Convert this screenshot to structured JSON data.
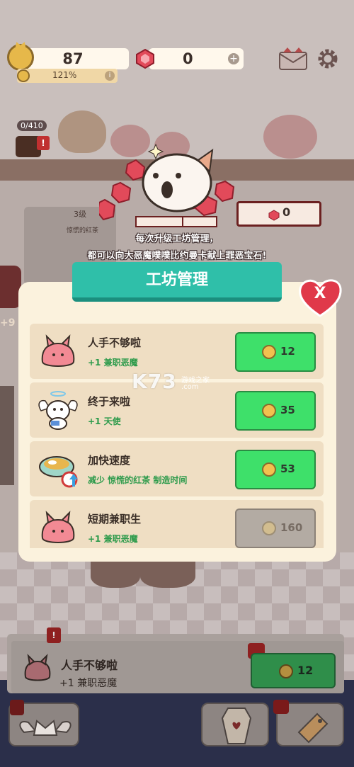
{
  "hud": {
    "coins": "87",
    "coin_rate": "121%",
    "gems": "0",
    "info_symbol": "i",
    "plus_symbol": "+"
  },
  "background": {
    "seat_counter": "0/410",
    "machine_level": "3级",
    "machine_product": "惊慌的红茶",
    "partial_value": "+9"
  },
  "reward": {
    "gem_count": "0",
    "tip_line1": "每次升级工坊管理，",
    "tip_line2": "都可以向大恶魔噗噗比约曼卡献上罪恶宝石!"
  },
  "modal": {
    "title": "工坊管理",
    "close_label": "X",
    "items": [
      {
        "title": "人手不够啦",
        "desc": "+1 兼职恶魔",
        "cost": "12",
        "enabled": true,
        "icon": "pink-demon-blob-icon"
      },
      {
        "title": "终于来啦",
        "desc": "+1 天使",
        "cost": "35",
        "enabled": true,
        "icon": "angel-cat-icon"
      },
      {
        "title": "加快速度",
        "desc": "减少 惊慌的红茶 制造时间",
        "cost": "53",
        "enabled": true,
        "icon": "teacup-speed-icon"
      },
      {
        "title": "短期兼职生",
        "desc": "+1 兼职恶魔",
        "cost": "160",
        "enabled": false,
        "icon": "pink-demon-blob-icon"
      }
    ]
  },
  "watermark": {
    "brand": "K73",
    "sub": "游戏之家",
    "domain": ".com"
  },
  "bottom_panel": {
    "title": "人手不够啦",
    "desc": "+1 兼职恶魔",
    "cost": "12",
    "alert_symbol": "!"
  },
  "colors": {
    "modal_bg": "#fbf2dd",
    "title_teal": "#2fbfa9",
    "buy_green": "#3ee06a",
    "buy_disabled": "#b3aba3",
    "row_bg": "#efdec3",
    "desc_green": "#2b9a4a",
    "close_red": "#e0394a"
  }
}
